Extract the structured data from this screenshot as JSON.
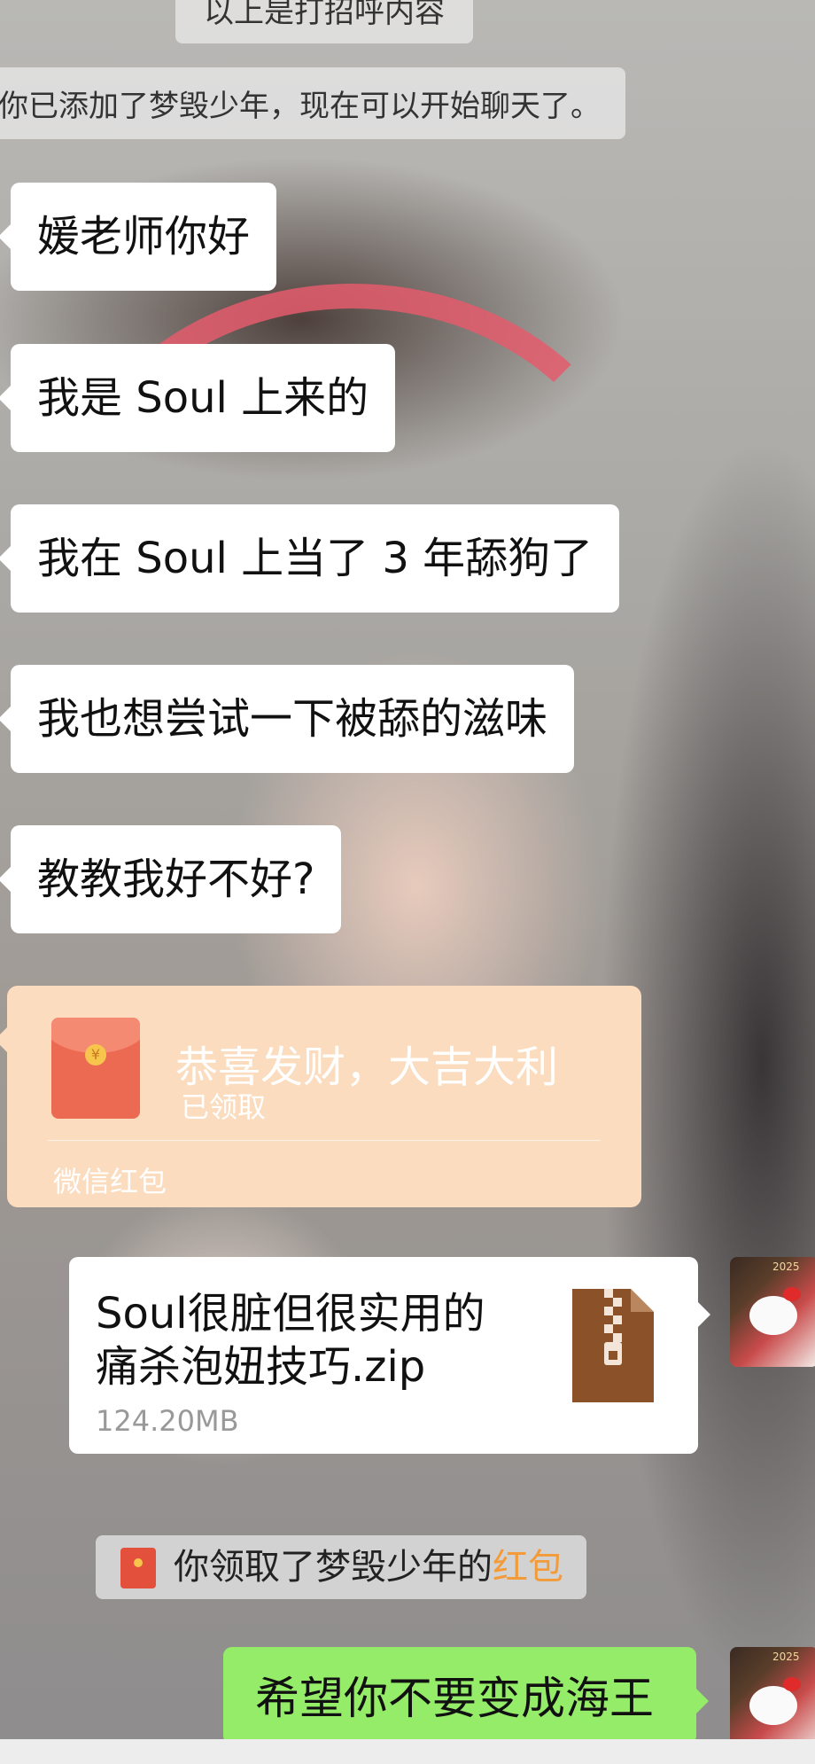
{
  "system_messages": {
    "top_partial": "以上是打招呼内容",
    "added_friend": "你已添加了梦毁少年，现在可以开始聊天了。"
  },
  "messages_left": [
    "媛老师你好",
    "我是 Soul 上来的",
    "我在 Soul 上当了 3 年舔狗了",
    "我也想尝试一下被舔的滋味",
    "教教我好不好?"
  ],
  "red_packet": {
    "title": "恭喜发财，大吉大利",
    "status": "已领取",
    "footer": "微信红包",
    "colors": {
      "card": "#fbdcbe",
      "envelope": "#ec6a52"
    }
  },
  "file_message": {
    "name": "Soul很脏但很实用的痛杀泡妞技巧.zip",
    "size": "124.20MB",
    "icon": "zip-file-icon"
  },
  "red_packet_notice": {
    "prefix": "你领取了梦毁少年的",
    "link": "红包",
    "link_color": "#f29b38"
  },
  "my_message": {
    "text": "希望你不要变成海王",
    "color": "#95ec69"
  },
  "avatar": {
    "icon": "hello-kitty-avatar",
    "badge_year": "2025"
  }
}
